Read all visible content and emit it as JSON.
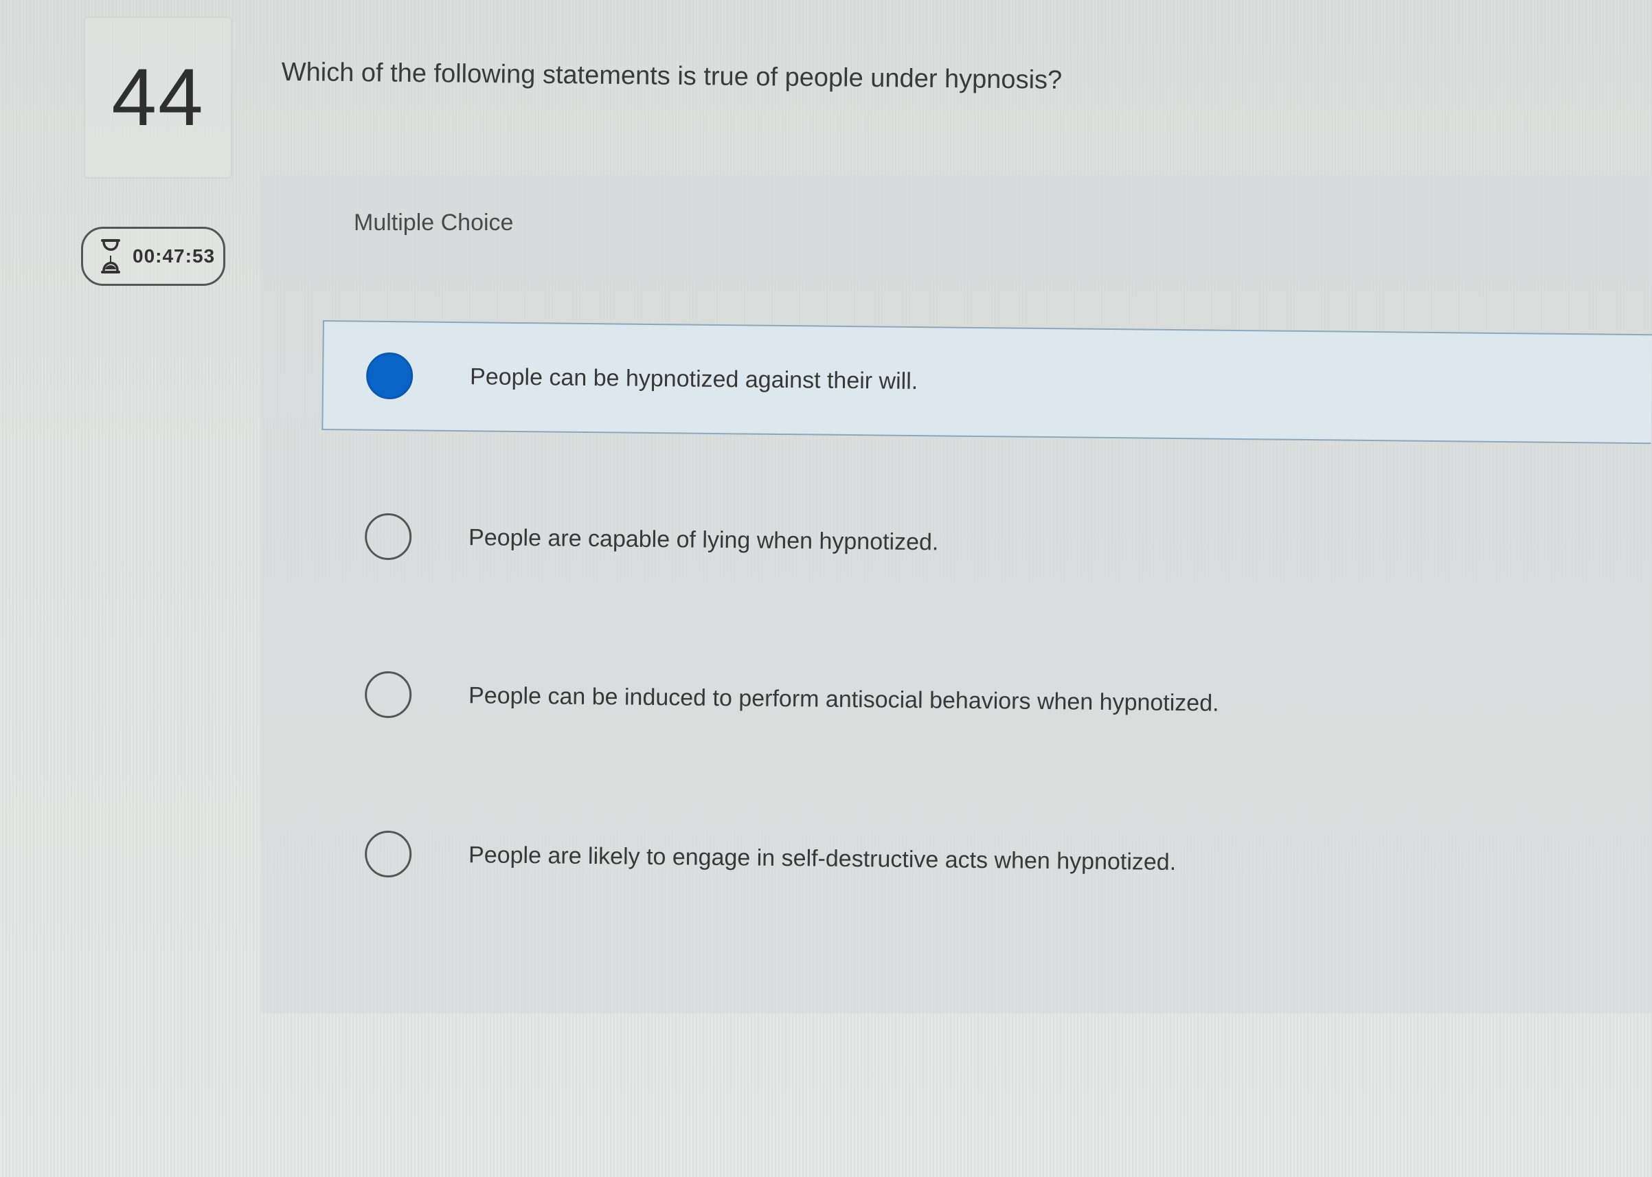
{
  "question": {
    "number": "44",
    "text": "Which of the following statements is true of people under hypnosis?",
    "type": "Multiple Choice"
  },
  "timer": {
    "icon": "hourglass-icon",
    "value": "00:47:53"
  },
  "choices": [
    {
      "label": "People can be hypnotized against their will.",
      "selected": true
    },
    {
      "label": "People are capable of lying when hypnotized.",
      "selected": false
    },
    {
      "label": "People can be induced to perform antisocial behaviors when hypnotized.",
      "selected": false
    },
    {
      "label": "People are likely to engage in self-destructive acts when hypnotized.",
      "selected": false
    }
  ],
  "colors": {
    "selected_radio": "#0a63c7",
    "selected_bg": "#dce7ee"
  }
}
